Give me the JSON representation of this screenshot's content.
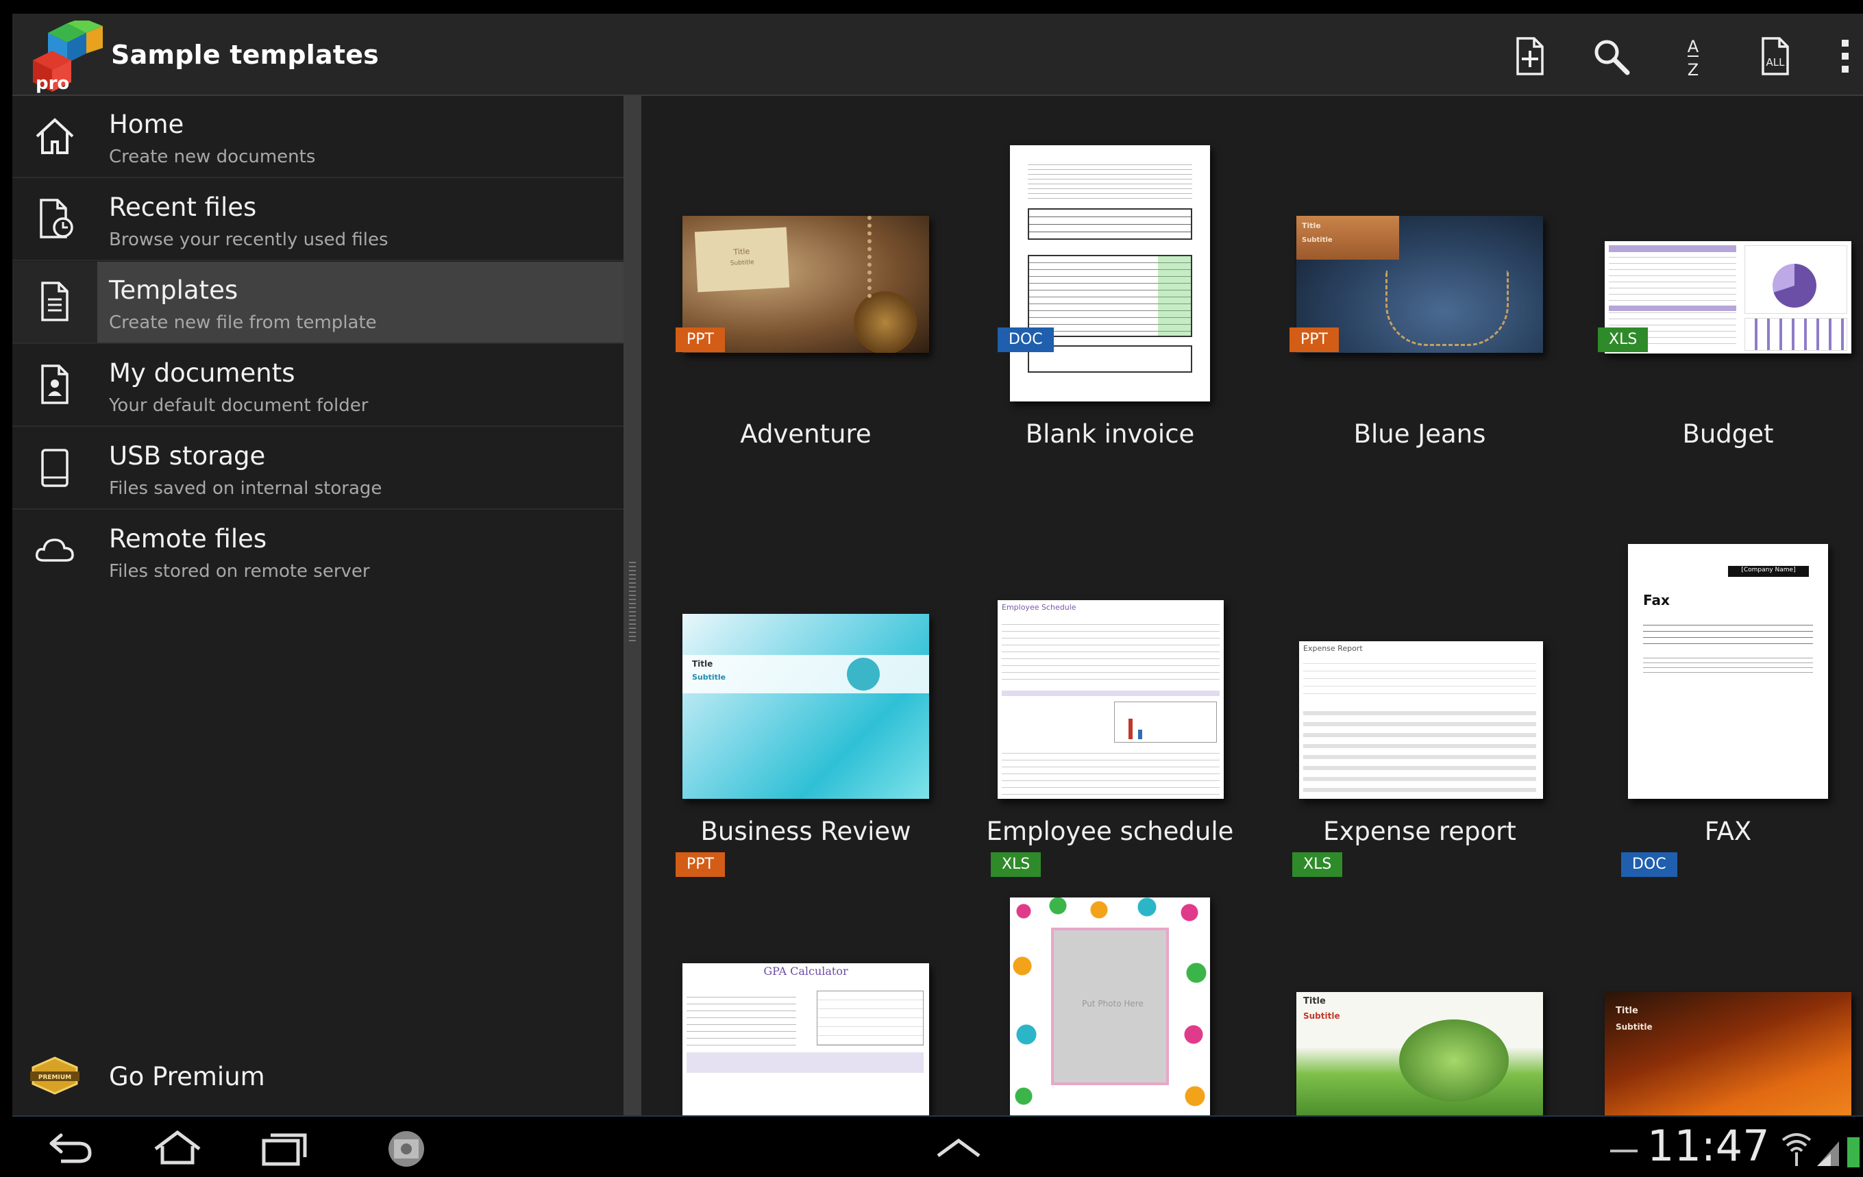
{
  "app": {
    "title": "Sample templates",
    "logo_text": "pro"
  },
  "toolbar": {
    "icons": [
      "new-file-icon",
      "search-icon",
      "sort-az-icon",
      "filter-all-icon",
      "overflow-menu-icon"
    ],
    "sort_label_top": "A",
    "sort_label_bottom": "Z",
    "filter_label": "ALL"
  },
  "sidebar": {
    "items": [
      {
        "label": "Home",
        "sub": "Create new documents",
        "icon": "home-icon",
        "active": false
      },
      {
        "label": "Recent files",
        "sub": "Browse your recently used files",
        "icon": "recent-files-icon",
        "active": false
      },
      {
        "label": "Templates",
        "sub": "Create new file from template",
        "icon": "templates-icon",
        "active": true
      },
      {
        "label": "My documents",
        "sub": "Your default document folder",
        "icon": "my-documents-icon",
        "active": false
      },
      {
        "label": "USB storage",
        "sub": "Files saved on internal storage",
        "icon": "usb-storage-icon",
        "active": false
      },
      {
        "label": "Remote files",
        "sub": "Files stored on remote server",
        "icon": "cloud-icon",
        "active": false
      }
    ],
    "premium": {
      "label": "Go Premium",
      "badge_text": "PREMIUM"
    }
  },
  "templates": [
    {
      "name": "Adventure",
      "type": "PPT",
      "thumb_title": "Title",
      "thumb_subtitle": "Subtitle"
    },
    {
      "name": "Blank invoice",
      "type": "DOC"
    },
    {
      "name": "Blue Jeans",
      "type": "PPT",
      "thumb_title": "Title",
      "thumb_subtitle": "Subtitle"
    },
    {
      "name": "Budget",
      "type": "XLS"
    },
    {
      "name": "Business Review",
      "type": "PPT",
      "thumb_title": "Title",
      "thumb_subtitle": "Subtitle"
    },
    {
      "name": "Employee schedule",
      "type": "XLS",
      "thumb_title": "Employee Schedule"
    },
    {
      "name": "Expense report",
      "type": "XLS",
      "thumb_title": "Expense Report"
    },
    {
      "name": "FAX",
      "type": "DOC",
      "thumb_title": "Fax",
      "thumb_company": "[Company Name]"
    },
    {
      "name": "",
      "type": "",
      "thumb_title": "GPA Calculator"
    },
    {
      "name": "",
      "type": "",
      "thumb_caption": "Put Photo Here"
    },
    {
      "name": "",
      "type": "",
      "thumb_title": "Title",
      "thumb_subtitle": "Subtitle"
    },
    {
      "name": "",
      "type": "",
      "thumb_title": "Title",
      "thumb_subtitle": "Subtitle"
    }
  ],
  "system_bar": {
    "time": "11:47",
    "icons": [
      "back-icon",
      "home-nav-icon",
      "recent-apps-icon",
      "screenshot-icon",
      "up-arrow-icon",
      "wifi-icon",
      "signal-icon",
      "battery-icon"
    ]
  },
  "colors": {
    "ppt_badge": "#d35d16",
    "doc_badge": "#1f5fad",
    "xls_badge": "#2f8a2a",
    "active_item": "#414141"
  }
}
